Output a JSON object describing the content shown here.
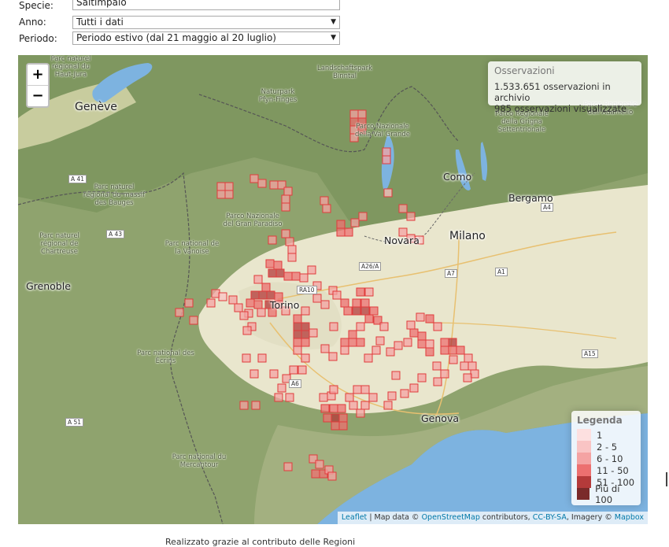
{
  "form": {
    "species_label": "Specie:",
    "species_value": "Saltimpalo",
    "year_label": "Anno:",
    "year_value": "Tutti i dati",
    "period_label": "Periodo:",
    "period_value": "Periodo estivo (dal 21 maggio al 20 luglio)"
  },
  "map": {
    "zoom_in": "+",
    "zoom_out": "−",
    "observations": {
      "title": "Osservazioni",
      "archive": "1.533.651 osservazioni in archivio",
      "shown": "985 osservazioni visualizzate"
    },
    "legend": {
      "title": "Legenda",
      "items": [
        {
          "label": "1",
          "color": "#fde0e0"
        },
        {
          "label": "2 - 5",
          "color": "#f9c4c4"
        },
        {
          "label": "6 - 10",
          "color": "#f4a3a3"
        },
        {
          "label": "11 - 50",
          "color": "#ec7070"
        },
        {
          "label": "51 - 100",
          "color": "#b43a3a"
        },
        {
          "label": "Più di 100",
          "color": "#7a2a2a"
        }
      ]
    },
    "attribution": {
      "leaflet": "Leaflet",
      "map_data": "| Map data ©",
      "osm": "OpenStreetMap",
      "contributors": "contributors,",
      "license": "CC-BY-SA",
      "imagery": ", Imagery ©",
      "mapbox": "Mapbox"
    },
    "cities": [
      {
        "name": "Genève",
        "big": true
      },
      {
        "name": "Torino",
        "big": false
      },
      {
        "name": "Milano",
        "big": true
      },
      {
        "name": "Novara",
        "big": false
      },
      {
        "name": "Como",
        "big": false
      },
      {
        "name": "Bergamo",
        "big": false
      },
      {
        "name": "Genova",
        "big": false
      },
      {
        "name": "Grenoble",
        "big": false
      }
    ],
    "places": [
      "Parc naturel régional du Haut-Jura",
      "Landschaftspark Binntal",
      "Naturpark Pfyn-Finges",
      "Parco Nazionale della Val Grande",
      "Parco Regionale della Grigna Settentrionale",
      "Parco Regionale dell'Adamello",
      "Parc naturel régional du massif des Bauges",
      "Parco Nazionale del Gran Paradiso",
      "Parc naturel régional de Chartreuse",
      "Parc national de la Vanoise",
      "Parc national des Écrins",
      "Parc national du Mercantour"
    ],
    "roads": [
      "A 41",
      "A 43",
      "A 51",
      "A4",
      "A26/A",
      "RA10",
      "A7",
      "A1",
      "A6",
      "A15"
    ],
    "colors": {
      "water": "#7db3e0",
      "lowland": "#e9e7cf",
      "mountain": "#8ca06b",
      "cell_stroke": "#e03b3b"
    }
  },
  "footer": "Realizzato grazie al contributo delle Regioni"
}
